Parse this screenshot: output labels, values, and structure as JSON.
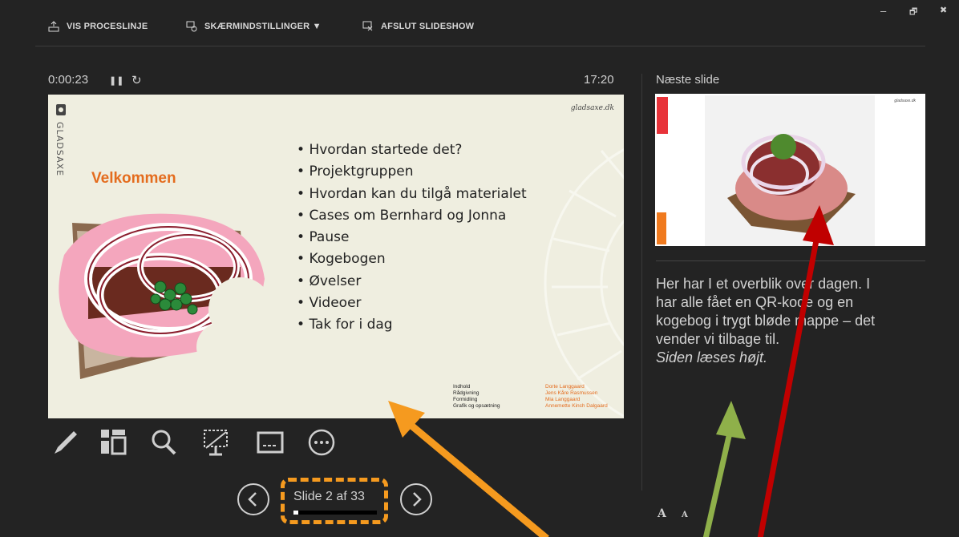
{
  "toolbar": {
    "show_taskbar": "VIS PROCESLINJE",
    "display_settings": "SKÆRMINDSTILLINGER ▼",
    "end_slideshow": "AFSLUT SLIDESHOW"
  },
  "window_controls": {
    "minimize": "–",
    "restore": "🗗",
    "close": "✖"
  },
  "timer": {
    "elapsed": "0:00:23",
    "pause_glyph": "❚❚",
    "restart_glyph": "↻",
    "clock": "17:20"
  },
  "next_slide_label": "Næste slide",
  "current_slide": {
    "site": "gladsaxe.dk",
    "brand": "GLADSAXE",
    "title": "Velkommen",
    "bullets": [
      "Hvordan startede det?",
      "Projektgruppen",
      "Hvordan kan du tilgå materialet",
      "Cases om Bernhard og Jonna",
      "Pause",
      "Kogebogen",
      "Øvelser",
      "Videoer",
      "Tak for i dag"
    ],
    "credit_roles": [
      "Indhold",
      "Rådgivning",
      "Formidling",
      "Grafik og opsætning"
    ],
    "credit_names": [
      "Dorte Langgaard",
      "Jens Kåre Rasmussen",
      "Mia Langgaard",
      "Annemette Kinch Dalgaard"
    ]
  },
  "next_preview": {
    "site": "gladsaxe.dk"
  },
  "notes": {
    "line1": "Her har I et overblik over dagen. I",
    "line2": "har alle fået en QR-kode og en",
    "line3": "kogebog i trygt bløde mappe – det",
    "line4": "vender vi tilbage til.",
    "line5": "Siden læses højt."
  },
  "navigation": {
    "counter": "Slide 2 af 33",
    "progress": 0.06
  },
  "font_buttons": {
    "larger": "A",
    "smaller": "A"
  },
  "colors": {
    "background": "#232323",
    "accent_orange": "#f59a1f",
    "arrow_green": "#8fb04a",
    "arrow_red": "#c00000"
  }
}
